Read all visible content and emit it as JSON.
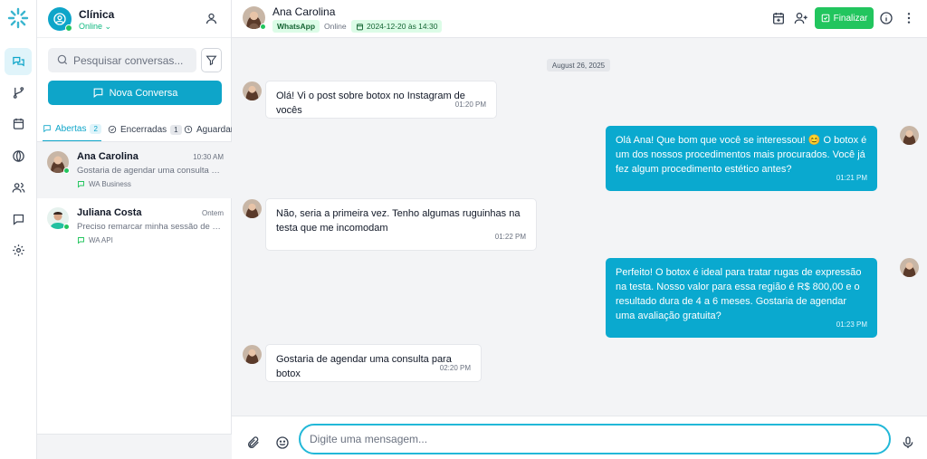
{
  "workspace": {
    "name": "Clínica",
    "status": "Online ⌄"
  },
  "sidebar": {
    "search_placeholder": "Pesquisar conversas...",
    "new_conversation": "Nova Conversa",
    "tabs": [
      {
        "label": "Abertas",
        "count": "2"
      },
      {
        "label": "Encerradas",
        "count": "1"
      },
      {
        "label": "Aguardando",
        "count": ""
      }
    ],
    "conversations": [
      {
        "name": "Ana Carolina",
        "time": "10:30 AM",
        "preview": "Gostaria de agendar uma consulta para botox",
        "channel": "WA Business"
      },
      {
        "name": "Juliana Costa",
        "time": "Ontem",
        "preview": "Preciso remarcar minha sessão de harmonização",
        "channel": "WA API"
      }
    ]
  },
  "chat": {
    "contact_name": "Ana Carolina",
    "channel_badge": "WhatsApp",
    "status": "Online",
    "scheduled": "2024-12-20 às 14:30",
    "finalize_label": "Finalizar",
    "date_divider": "August 26, 2025",
    "messages": [
      {
        "dir": "in",
        "text": "Olá! Vi o post sobre botox no Instagram de vocês",
        "time": "01:20 PM"
      },
      {
        "dir": "out",
        "text": "Olá Ana! Que bom que você se interessou! 😊 O botox é um dos nossos procedimentos mais procurados. Você já fez algum procedimento estético antes?",
        "time": "01:21 PM"
      },
      {
        "dir": "in",
        "text": "Não, seria a primeira vez. Tenho algumas ruguinhas na testa que me incomodam",
        "time": "01:22 PM"
      },
      {
        "dir": "out",
        "text": "Perfeito! O botox é ideal para tratar rugas de expressão na testa. Nosso valor para essa região é R$ 800,00 e o resultado dura de 4 a 6 meses. Gostaria de agendar uma avaliação gratuita?",
        "time": "01:23 PM"
      },
      {
        "dir": "in",
        "text": "Gostaria de agendar uma consulta para botox",
        "time": "02:20 PM"
      }
    ],
    "compose_placeholder": "Digite uma mensagem..."
  },
  "colors": {
    "accent": "#0ea5c9",
    "online": "#22c55e",
    "finalize": "#22c55e"
  },
  "icons": [
    "logo-icon",
    "chat-icon",
    "branch-icon",
    "calendar-icon",
    "globe-icon",
    "users-icon",
    "message-icon",
    "gear-icon",
    "user-icon",
    "search-icon",
    "filter-icon",
    "clock-icon",
    "calendar-plus-icon",
    "user-plus-icon",
    "check-square-icon",
    "info-icon",
    "more-vertical-icon",
    "paperclip-icon",
    "smile-icon",
    "mic-icon"
  ]
}
